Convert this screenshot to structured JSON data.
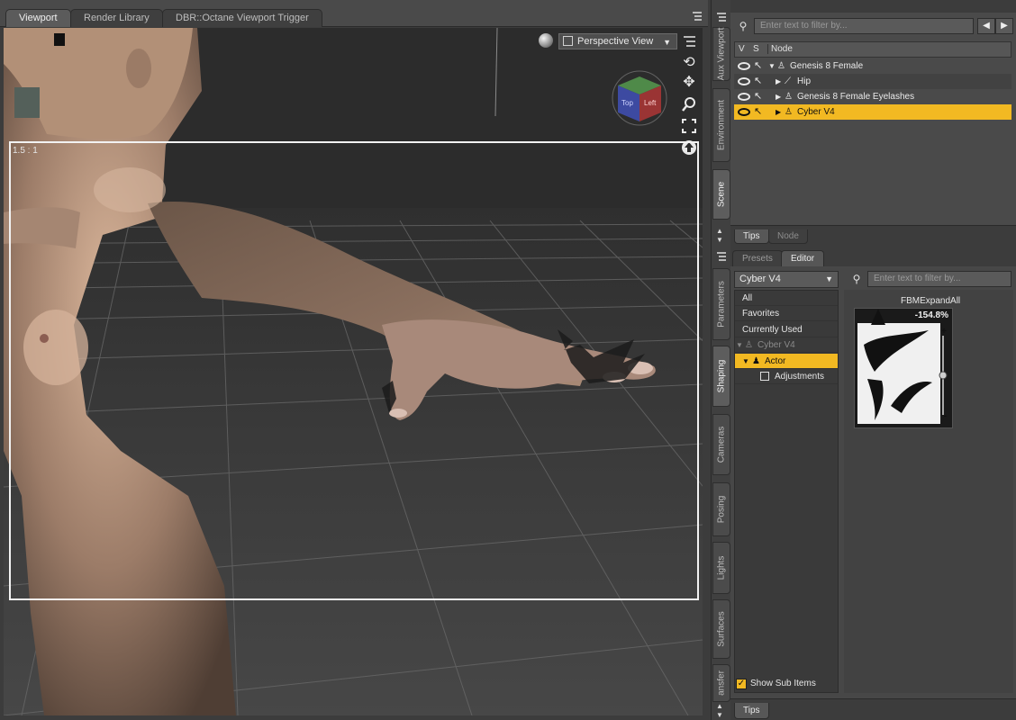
{
  "viewport_tabs": [
    {
      "label": "Viewport",
      "active": true
    },
    {
      "label": "Render Library",
      "active": false
    },
    {
      "label": "DBR::Octane Viewport Trigger",
      "active": false
    }
  ],
  "viewport": {
    "view_select": "Perspective View",
    "aspect_ratio": "1.5 : 1",
    "cube_faces": {
      "front": "Top",
      "side": "Left"
    }
  },
  "side_tabs": [
    {
      "label": "Aux Viewport",
      "active": false
    },
    {
      "label": "Environment",
      "active": false
    },
    {
      "label": "Scene",
      "active": true
    },
    {
      "label": "Parameters",
      "active": false
    },
    {
      "label": "Shaping",
      "active": true
    },
    {
      "label": "Cameras",
      "active": false
    },
    {
      "label": "Posing",
      "active": false
    },
    {
      "label": "Lights",
      "active": false
    },
    {
      "label": "Surfaces",
      "active": false
    },
    {
      "label": "ansfer",
      "active": false
    }
  ],
  "scene": {
    "filter_placeholder": "Enter text to filter by...",
    "columns": {
      "v": "V",
      "s": "S",
      "node": "Node"
    },
    "rows": [
      {
        "label": "Genesis 8 Female",
        "selected": false
      },
      {
        "label": "Hip",
        "selected": false
      },
      {
        "label": "Genesis 8 Female Eyelashes",
        "selected": false
      },
      {
        "label": "Cyber V4",
        "selected": true
      }
    ],
    "bottom_tabs": [
      {
        "label": "Tips",
        "active": true
      },
      {
        "label": "Node",
        "active": false
      }
    ]
  },
  "shaping": {
    "top_tabs": [
      {
        "label": "Presets",
        "active": false
      },
      {
        "label": "Editor",
        "active": true
      }
    ],
    "figure_select": "Cyber V4",
    "filter_placeholder": "Enter text to filter by...",
    "tree": [
      {
        "label": "All",
        "selected": false
      },
      {
        "label": "Favorites",
        "selected": false
      },
      {
        "label": "Currently Used",
        "selected": false
      },
      {
        "label": "Cyber V4",
        "selected": false
      },
      {
        "label": "Actor",
        "selected": true
      },
      {
        "label": "Adjustments",
        "selected": false
      }
    ],
    "show_sub_items_label": "Show Sub Items",
    "show_sub_items_checked": true,
    "property": {
      "name": "FBMExpandAll",
      "value": "-154.8%",
      "plus": "+",
      "minus": "-"
    },
    "bottom_tab": "Tips"
  },
  "colors": {
    "selection": "#f2b922",
    "panel_bg": "#474747",
    "viewport_bg": "#2c2c2c"
  }
}
